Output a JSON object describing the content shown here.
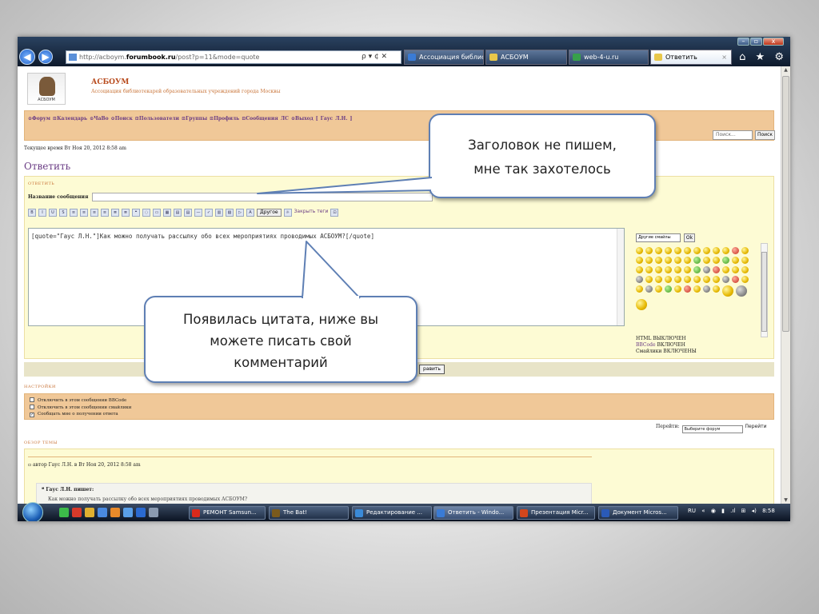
{
  "browser": {
    "url_prefix": "http://acboym.",
    "url_domain": "forumbook.ru",
    "url_path": "/post?p=11&mode=quote",
    "address_controls": "ρ ▾ ¢ ✕",
    "tabs": [
      {
        "label": "Ассоциация библио...",
        "icon_color": "#3a7bd5"
      },
      {
        "label": "АСБОУМ",
        "icon_color": "#e8c74a"
      },
      {
        "label": "web-4-u.ru",
        "icon_color": "#37a04a"
      },
      {
        "label": "Ответить",
        "icon_color": "#e8c74a",
        "active": true
      }
    ],
    "tab_close": "×",
    "toolbar_icons": "⌂ ★ ⚙",
    "window_buttons": [
      "–",
      "▫",
      "x"
    ]
  },
  "forum": {
    "site_name": "АСБОУМ",
    "site_desc": "Ассоциация библиотекарей образовательных учреждений города Москвы",
    "logo_caption": "АСБОУМ",
    "nav_links": "⊙Форум ⊡Календарь ⊙ЧаВо ⊙Поиск ⊡Пользователи ⊡Группы ⊡Профиль ⊡Сообщения ЛС ⊙Выход [ Гаус Л.Н. ]",
    "search_placeholder": "Поиск...",
    "search_button": "Поиск",
    "current_time": "Текущее время Вт Ноя 20, 2012 8:58 am",
    "reply_heading": "Ответить",
    "reply_panel_label": "ОТВЕТИТЬ",
    "subject_label": "Название сообщения",
    "toolbar_buttons": [
      "B",
      "I",
      "U",
      "S",
      "≡",
      "≡",
      "≡",
      "≡",
      "≣",
      "≣",
      "❝",
      "◌",
      "▭",
      "▦",
      "▤",
      "▤",
      "—",
      "✓",
      "▥",
      "▧",
      "▷",
      "A"
    ],
    "other_button": "Другое",
    "close_tags": "Закрыть теги",
    "editor_text": "[quote=\"Гаус Л.Н.\"]Как можно получать рассылку обо всех мероприятиях проводимых АСБОУМ?[/quote]",
    "smiley_select": "Другие смайлы",
    "smiley_ok": "Ok",
    "html_status": "HTML ВЫКЛЮЧЕН",
    "bbcode_word": "BBCode",
    "bbcode_status": " ВКЛЮЧЕН",
    "smilies_status": "Смайлики ВКЛЮЧЕНЫ",
    "send_button": "равить",
    "settings_label": "НАСТРОЙКИ",
    "settings": [
      {
        "text": "Отключить в этом сообщении BBCode",
        "checked": false
      },
      {
        "text": "Отключить в этом сообщении смайлики",
        "checked": false
      },
      {
        "text": "Сообщать мне о получении ответа",
        "checked": true
      }
    ],
    "jump_label": "Перейти:",
    "jump_select": "Выберите форум",
    "jump_go": "Перейти",
    "review_label": "ОБЗОР ТЕМЫ",
    "review_author": "▫ автор Гаус Л.Н. в Вт Ноя 20, 2012 8:58 am",
    "quote_header": "❝ Гаус Л.Н. пишет:",
    "quote_text": "Как можно получать рассылку обо всех мероприятиях проводимых АСБОУМ?"
  },
  "callouts": {
    "top": [
      "Заголовок не пишем,",
      "мне так захотелось"
    ],
    "bottom": [
      "Появилась цитата, ниже вы",
      "можете писать свой",
      "комментарий"
    ]
  },
  "taskbar": {
    "buttons": [
      {
        "label": "РЕМОНТ Samsun...",
        "icon_color": "#d92a1c"
      },
      {
        "label": "The Bat!",
        "icon_color": "#7a5a1c"
      },
      {
        "label": "Редактирование ...",
        "icon_color": "#3a8ad8"
      },
      {
        "label": "Ответить - Windo...",
        "icon_color": "#3a7bd5"
      },
      {
        "label": "Презентация Micr...",
        "icon_color": "#d2461c"
      },
      {
        "label": "Документ Micros...",
        "icon_color": "#2a5ab8"
      }
    ],
    "lang": "RU",
    "tray_extra": "« ◉ ▮ .ıl ⊞ ◂)",
    "clock": "8:58"
  }
}
